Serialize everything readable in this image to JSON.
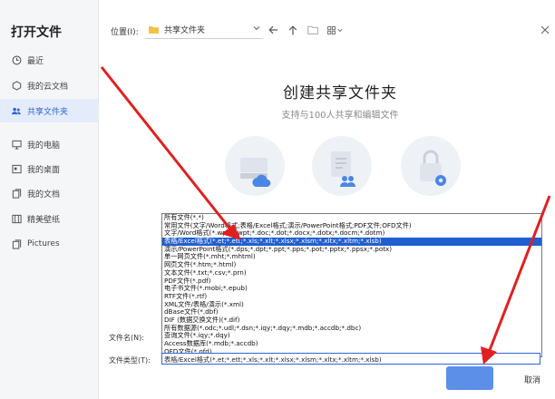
{
  "dialog": {
    "title": "打开文件"
  },
  "sidebar": {
    "items": [
      {
        "label": "最近",
        "icon": "clock-icon",
        "active": false
      },
      {
        "label": "我的云文档",
        "icon": "cloud-doc-icon",
        "active": false
      },
      {
        "label": "共享文件夹",
        "icon": "shared-folder-icon",
        "active": true
      },
      {
        "label": "我的电脑",
        "icon": "computer-icon",
        "active": false
      },
      {
        "label": "我的桌面",
        "icon": "desktop-icon",
        "active": false
      },
      {
        "label": "我的文档",
        "icon": "documents-icon",
        "active": false
      },
      {
        "label": "精美壁纸",
        "icon": "wallpaper-icon",
        "active": false
      },
      {
        "label": "Pictures",
        "icon": "pictures-icon",
        "active": false
      }
    ]
  },
  "location": {
    "label": "位置(I):",
    "value": "共享文件夹"
  },
  "main": {
    "title": "创建共享文件夹",
    "subtitle": "支持与100人共享和编辑文件"
  },
  "file_type_options": [
    "所有文件(*.*)",
    "常用文件(文字/Word格式;表格/Excel格式;演示/PowerPoint格式;PDF文件;OFD文件)",
    "文字/Word格式(*.wps;*.wpt;*.doc;*.dot;*.docx;*.dotx;*.docm;*.dotm)",
    "表格/Excel格式(*.et;*.ett;*.xls;*.xlt;*.xlsx;*.xlsm;*.xltx;*.xltm;*.xlsb)",
    "演示/PowerPoint格式(*.dps;*.dpt;*.ppt;*.pps;*.pot;*.pptx;*.ppsx;*.potx)",
    "单一网页文件(*.mht;*.mhtml)",
    "网页文件(*.htm;*.html)",
    "文本文件(*.txt;*.csv;*.prn)",
    "PDF文件(*.pdf)",
    "电子书文件(*.mobi;*.epub)",
    "RTF文件(*.rtf)",
    "XML文件/表格/演示(*.xml)",
    "dBase文件(*.dbf)",
    "DIF (数据交换文件)(*.dif)",
    "所有数据源(*.odc;*.udl;*.dsn;*.iqy;*.dqy;*.mdb;*.accdb;*.dbc)",
    "查询文件(*.iqy;*.dqy)",
    "Access数据库(*.mdb;*.accdb)",
    "OFD文件(*.ofd)"
  ],
  "selected_option_index": 3,
  "file_name_label": "文件名(N):",
  "file_type_label": "文件类型(T):",
  "file_type_value": "表格/Excel格式(*.et;*.ett;*.xls;*.xlt;*.xlsx;*.xlsm;*.xltx;*.xltm;*.xlsb)",
  "buttons": {
    "cancel": "取消"
  },
  "colors": {
    "accent": "#2e65d8",
    "selection": "#1f5fd0",
    "annotation_arrow": "#e02020"
  }
}
